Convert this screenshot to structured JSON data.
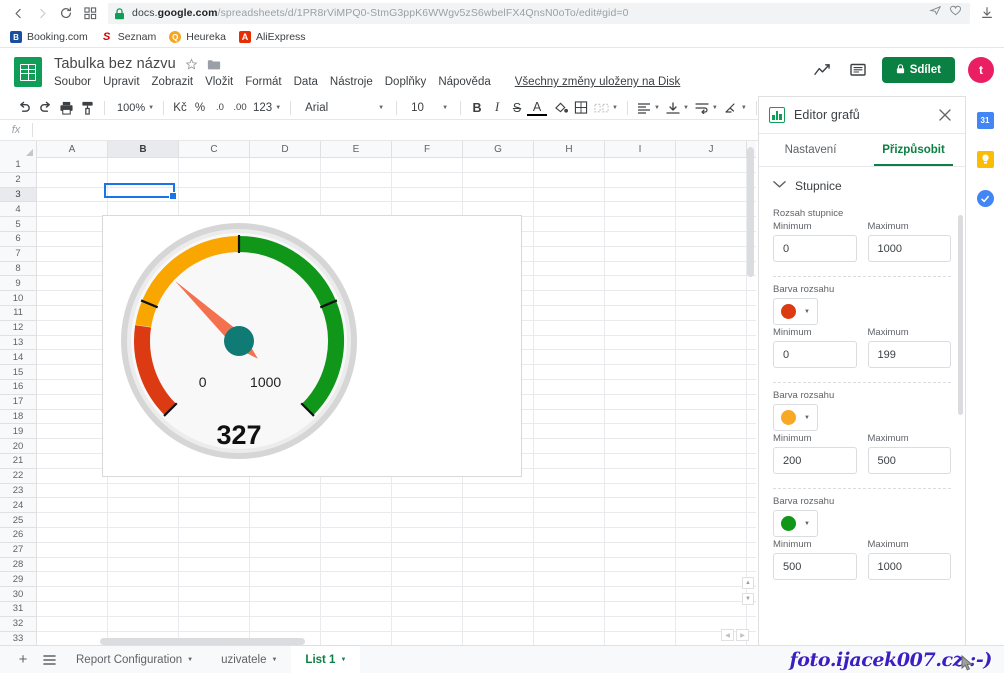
{
  "browser": {
    "url_prefix": "docs.",
    "url_domain": "google.com",
    "url_suffix": "/spreadsheets/d/1PR8rViMPQ0-StmG3ppK6WWgv5zS6wbelFX4QnsN0oTo/edit#gid=0",
    "back_icon": "back-arrow-icon",
    "forward_icon": "forward-arrow-icon",
    "reload_icon": "reload-icon",
    "apps_icon": "apps-grid-icon",
    "lock_icon": "lock-icon",
    "send_icon": "send-icon",
    "heart_icon": "heart-icon",
    "download_icon": "download-icon",
    "bookmarks": [
      {
        "label": "Booking.com",
        "mark": "B.",
        "color": "#1a4fa0"
      },
      {
        "label": "Seznam",
        "mark": "S",
        "color": "#cc0000"
      },
      {
        "label": "Heureka",
        "mark": "H",
        "color": "#f5a623"
      },
      {
        "label": "AliExpress",
        "mark": "A",
        "color": "#e62e04"
      }
    ]
  },
  "sheets_header": {
    "doc_title": "Tabulka bez názvu",
    "star_icon": "star-icon",
    "folder_icon": "folder-icon",
    "logo_icon": "google-sheets-logo-icon",
    "menus": [
      "Soubor",
      "Upravit",
      "Zobrazit",
      "Vložit",
      "Formát",
      "Data",
      "Nástroje",
      "Doplňky",
      "Nápověda"
    ],
    "save_state": "Všechny změny uloženy na Disk",
    "activity_icon": "activity-chart-icon",
    "comment_icon": "comment-icon",
    "share_label": "Sdílet",
    "share_lock_icon": "lock-icon",
    "share_color": "#0b8043",
    "avatar_letter": "t",
    "avatar_color": "#e91e63"
  },
  "toolbar": {
    "undo_icon": "undo-icon",
    "redo_icon": "redo-icon",
    "print_icon": "print-icon",
    "paint_format_icon": "paint-format-icon",
    "zoom_value": "100%",
    "currency_label": "Kč",
    "percent_label": "%",
    "decimal_dec_label": ".0",
    "decimal_inc_label": ".00",
    "format_label": "123",
    "font_family_value": "Arial",
    "font_size_value": "10",
    "bold_label": "B",
    "italic_label": "I",
    "strike_label": "S",
    "text_color_label": "A",
    "fill_color_icon": "fill-color-icon",
    "borders_icon": "borders-icon",
    "merge_icon": "merge-cells-icon",
    "halign_icon": "horizontal-align-icon",
    "valign_icon": "vertical-align-icon",
    "wrap_icon": "text-wrap-icon",
    "rotate_icon": "text-rotation-icon",
    "more_icon": "more-options-icon",
    "collapse_icon": "collapse-toolbar-icon"
  },
  "formula_bar": {
    "name_box": "fx",
    "value": ""
  },
  "grid": {
    "columns": [
      "A",
      "B",
      "C",
      "D",
      "E",
      "F",
      "G",
      "H",
      "I",
      "J"
    ],
    "selected_column": "B",
    "selected_row": "3",
    "selected_cell": "B3",
    "rows": [
      "1",
      "2",
      "3",
      "4",
      "5",
      "6",
      "7",
      "8",
      "9",
      "10",
      "11",
      "12",
      "13",
      "14",
      "15",
      "16",
      "17",
      "18",
      "19",
      "20",
      "21",
      "22",
      "23",
      "24",
      "25",
      "26",
      "27",
      "28",
      "29",
      "30",
      "31",
      "32",
      "33"
    ]
  },
  "chart_data": {
    "type": "gauge",
    "title": "",
    "value": 327,
    "value_label": "327",
    "min": 0,
    "max": 1000,
    "min_label": "0",
    "max_label": "1000",
    "needle_color": "#f4714f",
    "hub_color": "#107a75",
    "bands": [
      {
        "name": "red",
        "from": 0,
        "to": 199,
        "color": "#db3a12"
      },
      {
        "name": "orange",
        "from": 200,
        "to": 500,
        "color": "#f9a700"
      },
      {
        "name": "green",
        "from": 500,
        "to": 1000,
        "color": "#109618"
      }
    ],
    "major_ticks": [
      0,
      250,
      500,
      750,
      1000
    ],
    "face_color": "#f8f8f8",
    "rim_color": "#c8c8c8"
  },
  "editor": {
    "title": "Editor grafů",
    "logo_icon": "chart-editor-logo-icon",
    "close_icon": "close-icon",
    "tabs": [
      {
        "label": "Nastavení",
        "active": false
      },
      {
        "label": "Přizpůsobit",
        "active": true
      }
    ],
    "section": {
      "chevron_icon": "chevron-down-icon",
      "title": "Stupnice"
    },
    "scale_range": {
      "group_label": "Rozsah stupnice",
      "min_label": "Minimum",
      "max_label": "Maximum",
      "min_value": "0",
      "max_value": "1000"
    },
    "color_ranges": [
      {
        "group_label": "Barva rozsahu",
        "color": "#db3a12",
        "dropdown_icon": "color-dropdown-icon",
        "min_label": "Minimum",
        "max_label": "Maximum",
        "min_value": "0",
        "max_value": "199"
      },
      {
        "group_label": "Barva rozsahu",
        "color": "#f9a825",
        "dropdown_icon": "color-dropdown-icon",
        "min_label": "Minimum",
        "max_label": "Maximum",
        "min_value": "200",
        "max_value": "500"
      },
      {
        "group_label": "Barva rozsahu",
        "color": "#109618",
        "dropdown_icon": "color-dropdown-icon",
        "min_label": "Minimum",
        "max_label": "Maximum",
        "min_value": "500",
        "max_value": "1000"
      }
    ]
  },
  "side_rail": [
    {
      "name": "google-calendar-icon",
      "mark": "31",
      "color": "#4285f4"
    },
    {
      "name": "google-keep-icon",
      "mark": "",
      "color": "#fbbc04"
    },
    {
      "name": "google-tasks-icon",
      "mark": "",
      "color": "#4285f4"
    }
  ],
  "sheet_tabs": {
    "add_icon": "add-sheet-icon",
    "list_icon": "all-sheets-icon",
    "tabs": [
      {
        "label": "Report Configuration",
        "active": false
      },
      {
        "label": "uzivatele",
        "active": false
      },
      {
        "label": "List 1",
        "active": true
      }
    ]
  },
  "watermark": {
    "text": "foto.ijacek007.cz :-)"
  }
}
